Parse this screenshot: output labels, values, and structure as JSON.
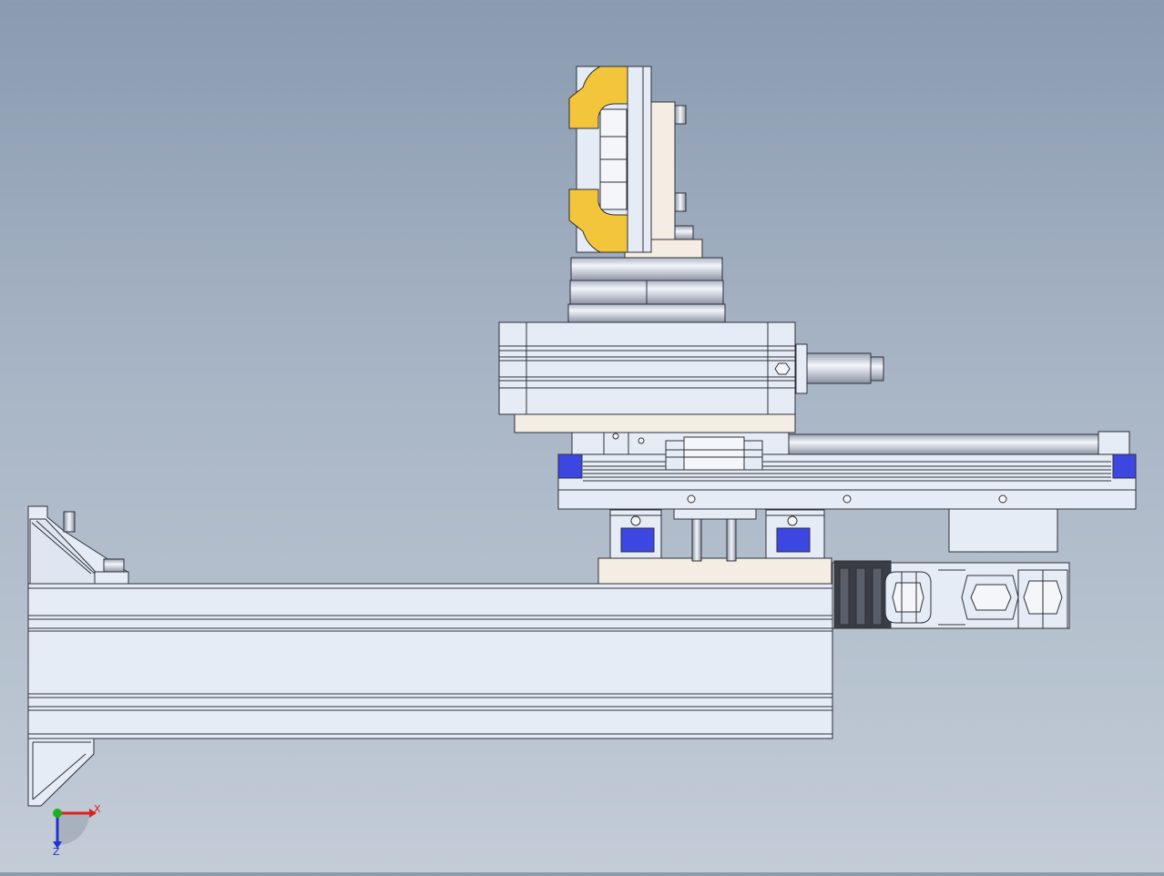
{
  "viewport": {
    "background_top": "#8a9bb0",
    "background_bottom": "#c3ccd7"
  },
  "colors": {
    "part_fill": "#e6ecf6",
    "part_stroke": "#2f2f38",
    "gripper_yellow": "#f2c53a",
    "slider_blue": "#3c46e0",
    "beige": "#f3ede3",
    "rod_steel": "#bfc7d4",
    "chain_dark": "#3a3d45"
  },
  "triad": {
    "x_label": "X",
    "z_label": "Z",
    "x_color": "#e0201c",
    "y_color": "#1fb01f",
    "z_color": "#2233cc"
  }
}
